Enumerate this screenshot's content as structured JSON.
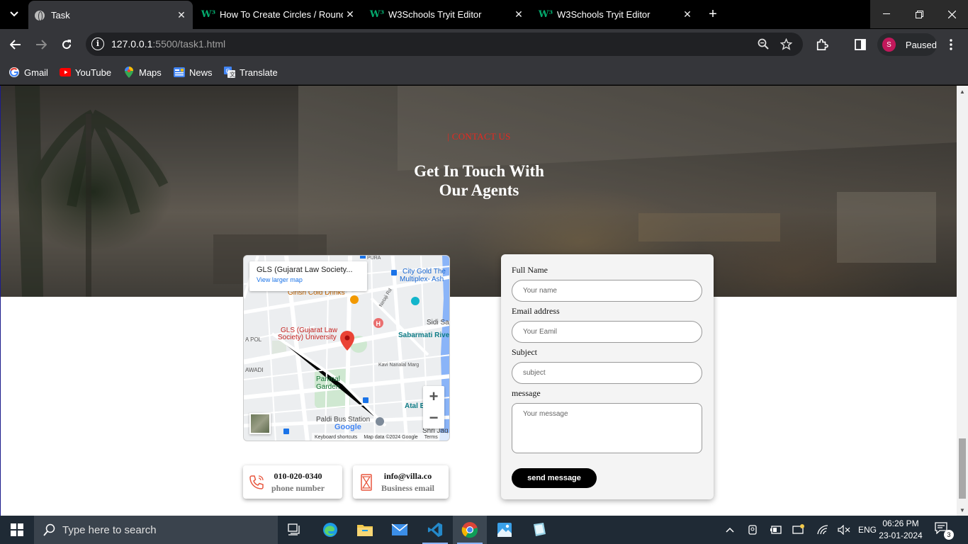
{
  "browser": {
    "tabs": [
      {
        "title": "Task",
        "icon": "globe-icon",
        "active": true
      },
      {
        "title": "How To Create Circles / Round D",
        "icon": "w3schools-icon",
        "active": false
      },
      {
        "title": "W3Schools Tryit Editor",
        "icon": "w3schools-icon",
        "active": false
      },
      {
        "title": "W3Schools Tryit Editor",
        "icon": "w3schools-icon",
        "active": false
      }
    ],
    "url_host": "127.0.0.1",
    "url_path": ":5500/task1.html",
    "profile_initial": "S",
    "profile_label": "Paused",
    "bookmarks": [
      {
        "label": "Gmail",
        "icon": "gmail-icon"
      },
      {
        "label": "YouTube",
        "icon": "youtube-icon"
      },
      {
        "label": "Maps",
        "icon": "maps-icon"
      },
      {
        "label": "News",
        "icon": "news-icon"
      },
      {
        "label": "Translate",
        "icon": "translate-icon"
      }
    ]
  },
  "page": {
    "eyebrow": "| CONTACT US",
    "title_line1": "Get In Touch With",
    "title_line2": "Our Agents",
    "map": {
      "place_name": "GLS (Gujarat Law Society...",
      "view_larger": "View larger map",
      "labels": {
        "city_gold": "City Gold The",
        "multiplex": "Multiplex- Ash",
        "girish": "Girish Cold Drinks",
        "gls1": "GLS (Gujarat Law",
        "gls2": "Society) University",
        "sidi": "Sidi Sa",
        "sabarmati": "Sabarmati Rive",
        "parimal1": "Parimal",
        "parimal2": "Garden",
        "kavi": "Kavi Nanalal Marg",
        "atal": "Atal B",
        "paldi": "Paldi Bus Station",
        "shri": "Shri Jaq",
        "pura": "PURA",
        "pol": "A POL",
        "awadi": "AWADI",
        "netaji": "Netaji Rd"
      },
      "footer_shortcuts": "Keyboard shortcuts",
      "footer_data": "Map data ©2024 Google",
      "footer_terms": "Terms",
      "google": "Google"
    },
    "phone": {
      "value": "010-020-0340",
      "label": "phone number"
    },
    "email": {
      "value": "info@villa.co",
      "label": "Business email"
    },
    "form": {
      "name_label": "Full Name",
      "name_placeholder": "Your name",
      "email_label": "Email address",
      "email_placeholder": "Your Eamil",
      "subject_label": "Subject",
      "subject_placeholder": "subject",
      "message_label": "message",
      "message_placeholder": "Your message",
      "submit": "send message"
    }
  },
  "taskbar": {
    "search_placeholder": "Type here to search",
    "language": "ENG",
    "time": "06:26 PM",
    "date": "23-01-2024",
    "notifications": "3"
  },
  "colors": {
    "accent_red": "#e8271f",
    "form_bg": "#f4f4f4",
    "button_bg": "#000000"
  }
}
